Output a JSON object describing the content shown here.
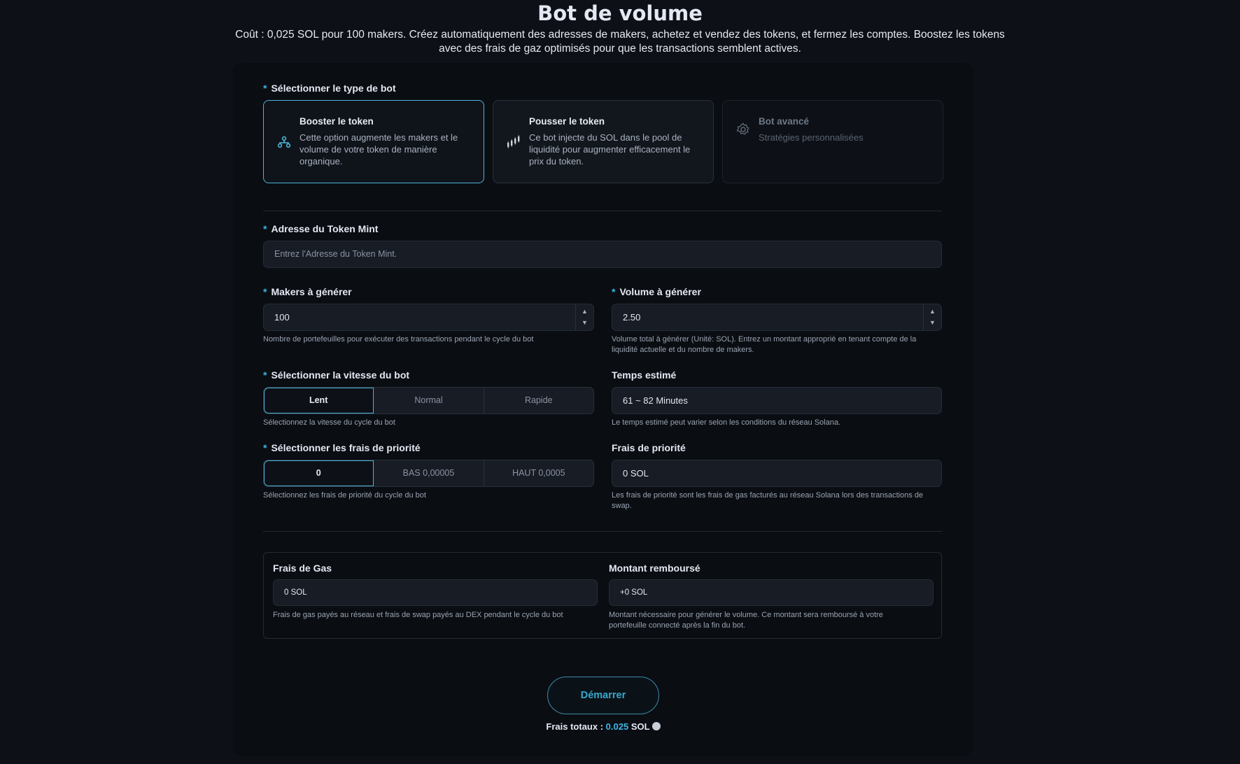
{
  "header": {
    "title": "Bot de volume",
    "subtitle": "Coût : 0,025 SOL pour 100 makers. Créez automatiquement des adresses de makers, achetez et vendez des tokens, et fermez les comptes. Boostez les tokens avec des frais de gaz optimisés pour que les transactions semblent actives."
  },
  "bot_type": {
    "label": "Sélectionner le type de bot",
    "options": [
      {
        "name": "Booster le token",
        "desc": "Cette option augmente les makers et le volume de votre token de manière organique.",
        "icon": "network-icon",
        "state": "selected"
      },
      {
        "name": "Pousser le token",
        "desc": "Ce bot injecte du SOL dans le pool de liquidité pour augmenter efficacement le prix du token.",
        "icon": "chart-up-icon",
        "state": "default"
      },
      {
        "name": "Bot avancé",
        "desc": "Stratégies personnalisées",
        "icon": "gear-icon",
        "state": "disabled"
      }
    ]
  },
  "mint": {
    "label": "Adresse du Token Mint",
    "placeholder": "Entrez l'Adresse du Token Mint."
  },
  "makers": {
    "label": "Makers à générer",
    "value": "100",
    "help": "Nombre de portefeuilles pour exécuter des transactions pendant le cycle du bot"
  },
  "volume": {
    "label": "Volume à générer",
    "value": "2.50",
    "help": "Volume total à générer (Unité: SOL). Entrez un montant approprié en tenant compte de la liquidité actuelle et du nombre de makers."
  },
  "speed": {
    "label": "Sélectionner la vitesse du bot",
    "options": [
      "Lent",
      "Normal",
      "Rapide"
    ],
    "selected": "Lent",
    "help": "Sélectionnez la vitesse du cycle du bot"
  },
  "estimated_time": {
    "label": "Temps estimé",
    "value": "61 ~ 82 Minutes",
    "help": "Le temps estimé peut varier selon les conditions du réseau Solana."
  },
  "priority_select": {
    "label": "Sélectionner les frais de priorité",
    "options": [
      "0",
      "BAS 0,00005",
      "HAUT 0,0005"
    ],
    "selected": "0",
    "help": "Sélectionnez les frais de priorité du cycle du bot"
  },
  "priority_fee": {
    "label": "Frais de priorité",
    "value": "0 SOL",
    "help": "Les frais de priorité sont les frais de gas facturés au réseau Solana lors des transactions de swap."
  },
  "gas": {
    "label": "Frais de Gas",
    "value": "0 SOL",
    "help": "Frais de gas payés au réseau et frais de swap payés au DEX pendant le cycle du bot"
  },
  "refund": {
    "label": "Montant remboursé",
    "value": "+0 SOL",
    "help": "Montant nécessaire pour générer le volume. Ce montant sera remboursé à votre portefeuille connecté après la fin du bot."
  },
  "start_button": "Démarrer",
  "total": {
    "prefix": "Frais totaux : ",
    "amount": "0.025",
    "unit": " SOL"
  },
  "colors": {
    "accent": "#3fb6e8",
    "background": "#0d1117",
    "card": "#0a0d12"
  }
}
